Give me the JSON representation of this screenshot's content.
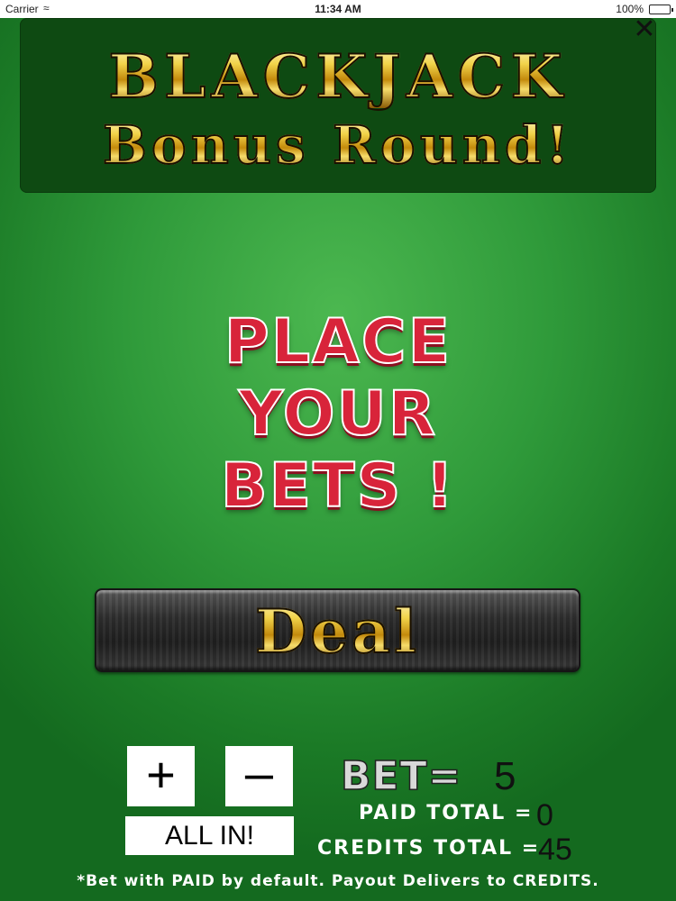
{
  "status_bar": {
    "carrier": "Carrier",
    "time": "11:34 AM",
    "battery": "100%"
  },
  "banner": {
    "title": "BLACKJACK",
    "subtitle": "Bonus Round!",
    "close_label": "✕"
  },
  "prompt": {
    "lines": [
      "PLACE",
      "YOUR",
      "BETS !"
    ]
  },
  "deal_button": {
    "label": "Deal"
  },
  "controls": {
    "plus_label": "+",
    "minus_label": "–",
    "all_in_label": "ALL IN!"
  },
  "bet": {
    "label": "BET=",
    "value": "5"
  },
  "totals": {
    "paid_label": "PAID TOTAL =",
    "paid_value": "0",
    "credits_label": "CREDITS TOTAL =",
    "credits_value": "45"
  },
  "footnote": "*Bet with PAID by default. Payout Delivers to CREDITS.",
  "colors": {
    "felt": "#2f9a3a",
    "banner": "#0e4a12",
    "prompt_red": "#d8243a",
    "gold": "#f1d34a"
  }
}
